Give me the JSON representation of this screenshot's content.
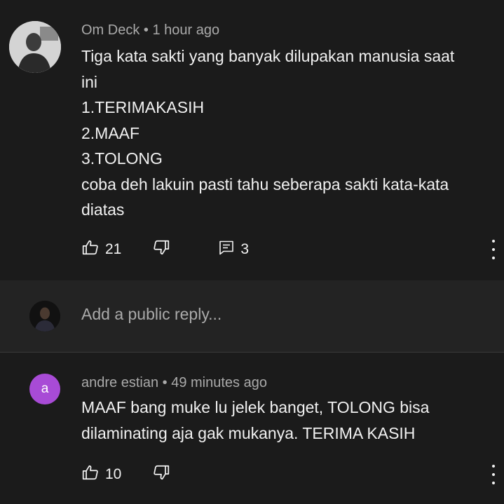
{
  "comment1": {
    "author": "Om Deck",
    "time": "1 hour ago",
    "lines": [
      "Tiga kata sakti yang banyak dilupakan manusia saat",
      "ini",
      "1.TERIMAKASIH",
      "2.MAAF",
      "3.TOLONG",
      "coba deh lakuin pasti tahu seberapa sakti kata-kata",
      "diatas"
    ],
    "likes": "21",
    "replies": "3"
  },
  "reply_box": {
    "placeholder": "Add a public reply..."
  },
  "comment2": {
    "avatar_letter": "a",
    "author": "andre estian",
    "time": "49 minutes ago",
    "lines": [
      "MAAF bang muke lu jelek banget, TOLONG bisa",
      "dilaminating aja gak mukanya. TERIMA KASIH"
    ],
    "likes": "10"
  },
  "colors": {
    "background": "#1b1b1b",
    "reply_bar": "#232323",
    "avatar_a": "#a84bd6",
    "muted_text": "#aaaaaa"
  },
  "icons": [
    "thumbs-up-icon",
    "thumbs-down-icon",
    "replies-icon",
    "more-vert-icon"
  ]
}
